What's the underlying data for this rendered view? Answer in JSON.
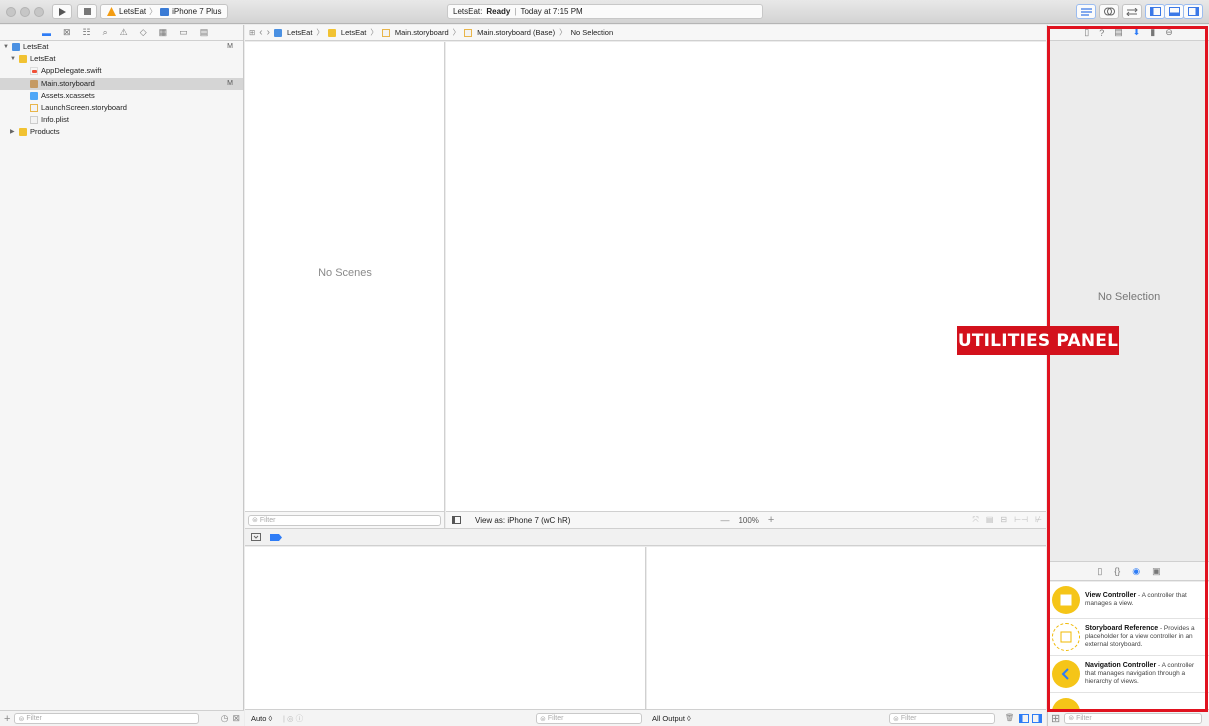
{
  "toolbar": {
    "scheme": {
      "project": "LetsEat",
      "device": "iPhone 7 Plus"
    },
    "status": {
      "app": "LetsEat:",
      "state": "Ready",
      "time": "Today at 7:15 PM"
    }
  },
  "navigator": {
    "items": [
      {
        "label": "LetsEat",
        "badge": "M"
      },
      {
        "label": "LetsEat",
        "badge": ""
      },
      {
        "label": "AppDelegate.swift",
        "badge": ""
      },
      {
        "label": "Main.storyboard",
        "badge": "M"
      },
      {
        "label": "Assets.xcassets",
        "badge": ""
      },
      {
        "label": "LaunchScreen.storyboard",
        "badge": ""
      },
      {
        "label": "Info.plist",
        "badge": ""
      },
      {
        "label": "Products",
        "badge": ""
      }
    ],
    "filter_placeholder": "Filter"
  },
  "jumpbar": {
    "crumbs": [
      "LetsEat",
      "LetsEat",
      "Main.storyboard",
      "Main.storyboard (Base)",
      "No Selection"
    ]
  },
  "editor": {
    "no_scenes": "No Scenes",
    "outline_filter_placeholder": "Filter",
    "view_as": "View as: iPhone 7 (wC hR)",
    "zoom": "100%",
    "zoom_minus": "—",
    "zoom_plus": "+"
  },
  "debug": {
    "auto_label": "Auto ◊",
    "filter_placeholder": "Filter",
    "console_output": "All Output ◊",
    "console_filter_placeholder": "Filter"
  },
  "utilities": {
    "no_selection": "No Selection",
    "library": [
      {
        "title": "View Controller",
        "desc": " - A controller that manages a view."
      },
      {
        "title": "Storyboard Reference",
        "desc": " - Provides a placeholder for a view controller in an external storyboard."
      },
      {
        "title": "Navigation Controller",
        "desc": " - A controller that manages navigation through a hierarchy of views."
      }
    ],
    "filter_placeholder": "Filter"
  },
  "annotation": {
    "label": "UTILITIES PANEL",
    "color": "#d3111c"
  }
}
